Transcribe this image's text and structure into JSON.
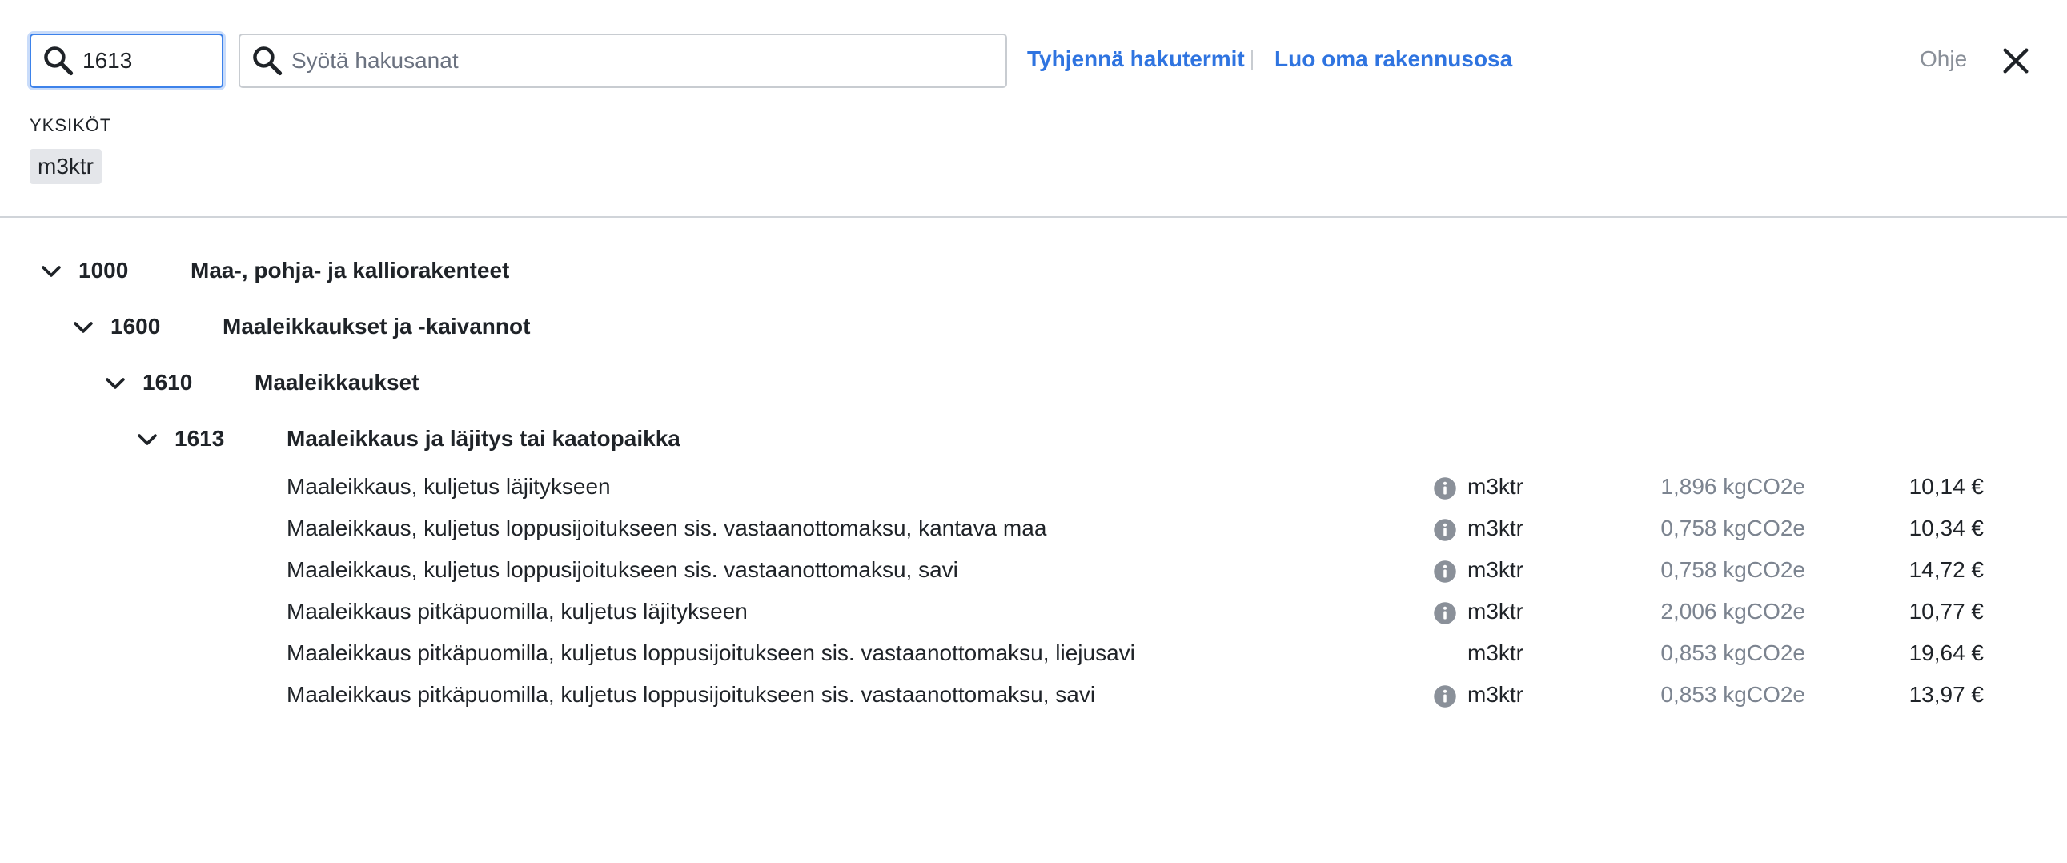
{
  "search": {
    "code_value": "1613",
    "code_placeholder": "",
    "words_value": "",
    "words_placeholder": "Syötä hakusanat"
  },
  "header": {
    "clear_label": "Tyhjennä hakutermit",
    "create_label": "Luo oma rakennusosa",
    "help_label": "Ohje"
  },
  "units": {
    "heading": "YKSIKÖT",
    "selected": "m3ktr"
  },
  "tree": [
    {
      "code": "1000",
      "title": "Maa-, pohja- ja kalliorakenteet",
      "expanded": true
    },
    {
      "code": "1600",
      "title": "Maaleikkaukset ja -kaivannot",
      "expanded": true
    },
    {
      "code": "1610",
      "title": "Maaleikkaukset",
      "expanded": true
    },
    {
      "code": "1613",
      "title": "Maaleikkaus ja läjitys tai kaatopaikka",
      "expanded": true
    }
  ],
  "items": [
    {
      "name": "Maaleikkaus, kuljetus läjitykseen",
      "info": true,
      "unit": "m3ktr",
      "co2": "1,896 kgCO2e",
      "price": "10,14 €"
    },
    {
      "name": "Maaleikkaus, kuljetus loppusijoitukseen sis. vastaanottomaksu, kantava maa",
      "info": true,
      "unit": "m3ktr",
      "co2": "0,758 kgCO2e",
      "price": "10,34 €"
    },
    {
      "name": "Maaleikkaus, kuljetus loppusijoitukseen sis. vastaanottomaksu, savi",
      "info": true,
      "unit": "m3ktr",
      "co2": "0,758 kgCO2e",
      "price": "14,72 €"
    },
    {
      "name": "Maaleikkaus pitkäpuomilla, kuljetus läjitykseen",
      "info": true,
      "unit": "m3ktr",
      "co2": "2,006 kgCO2e",
      "price": "10,77 €"
    },
    {
      "name": "Maaleikkaus pitkäpuomilla, kuljetus loppusijoitukseen sis. vastaanottomaksu, liejusavi",
      "info": false,
      "unit": "m3ktr",
      "co2": "0,853 kgCO2e",
      "price": "19,64 €"
    },
    {
      "name": "Maaleikkaus pitkäpuomilla, kuljetus loppusijoitukseen sis. vastaanottomaksu, savi",
      "info": true,
      "unit": "m3ktr",
      "co2": "0,853 kgCO2e",
      "price": "13,97 €"
    }
  ],
  "colors": {
    "accent": "#2f74e0",
    "focus_border": "#3d82ea",
    "muted_text": "#7c8490",
    "info_icon": "#8a9099"
  },
  "icons": {
    "search": "search-icon",
    "close": "close-icon",
    "chevron": "chevron-down-icon",
    "info": "info-icon"
  }
}
